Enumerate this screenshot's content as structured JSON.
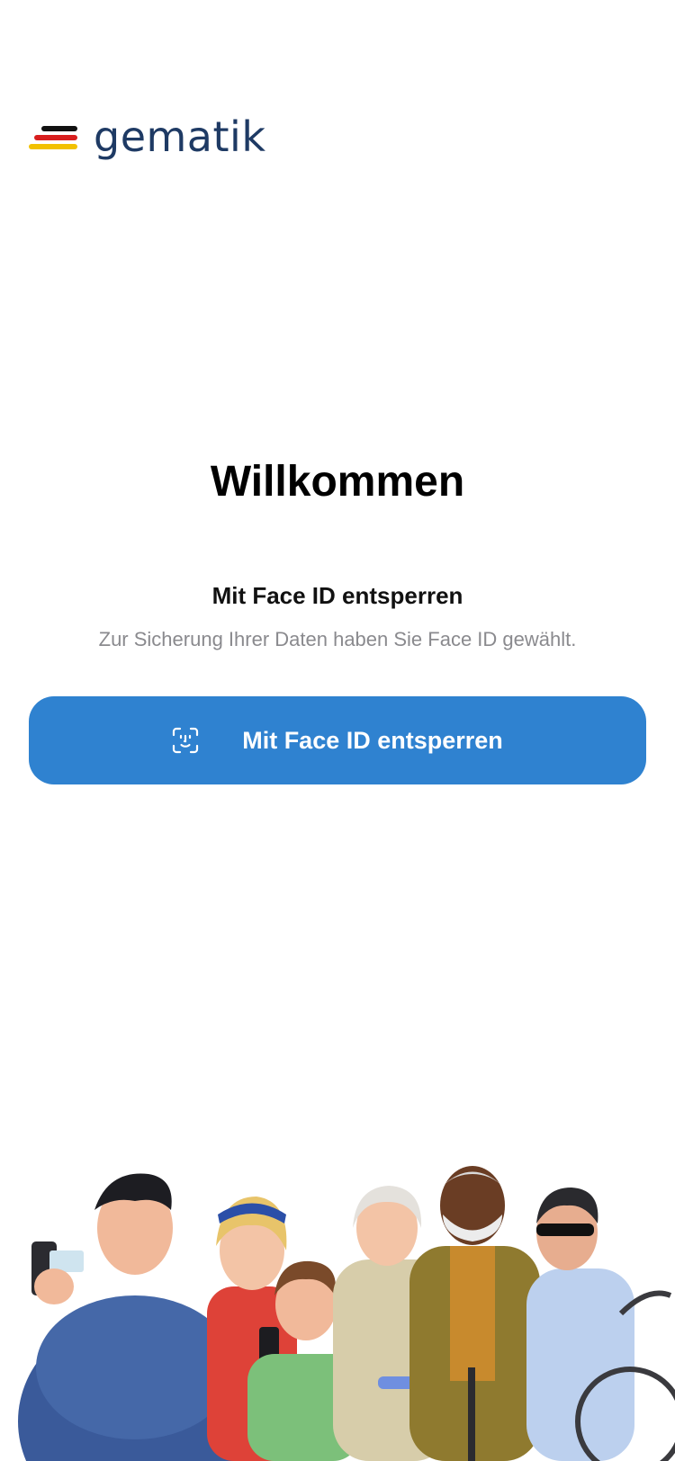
{
  "brand": {
    "logo_text": "gematik",
    "logo_colors": [
      "#111111",
      "#d81e1e",
      "#f2c100"
    ],
    "text_color": "#1e3a64"
  },
  "welcome": {
    "title": "Willkommen",
    "subtitle": "Mit Face ID entsperren",
    "description": "Zur Sicherung Ihrer Daten haben Sie Face ID gewählt."
  },
  "unlock_button": {
    "label": "Mit Face ID entsperren",
    "icon": "face-id-icon",
    "color": "#2f82d0"
  },
  "illustration": {
    "name": "people-group-illustration"
  }
}
